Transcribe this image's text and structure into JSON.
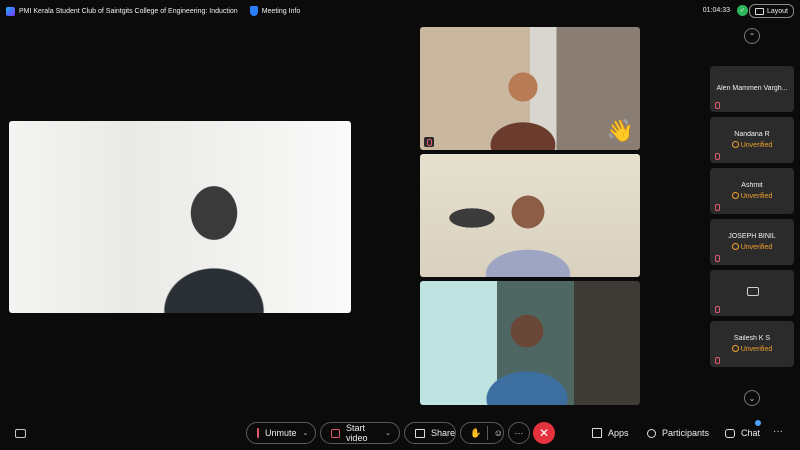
{
  "header": {
    "meeting_title": "PMI Kerala Student Club of Saintgits College of Engineering: Induction",
    "meeting_info_label": "Meeting Info",
    "timer": "01:04:33",
    "layout_label": "Layout"
  },
  "participants_panel": {
    "items": [
      {
        "name": "Alen Mammen Vargh...",
        "status": ""
      },
      {
        "name": "Nandana R",
        "status": "Unverified"
      },
      {
        "name": "Ashmit",
        "status": "Unverified"
      },
      {
        "name": "JOSEPH BINIL",
        "status": "Unverified"
      },
      {
        "name": "",
        "status": ""
      },
      {
        "name": "Sailesh K S",
        "status": "Unverified"
      }
    ]
  },
  "toolbar": {
    "unmute_label": "Unmute",
    "start_video_label": "Start video",
    "share_label": "Share",
    "apps_label": "Apps",
    "participants_label": "Participants",
    "chat_label": "Chat",
    "more_glyph": "···",
    "end_glyph": "✕"
  },
  "icons": {
    "wave": "👋",
    "scroll_up": "⌃",
    "scroll_down": "⌄",
    "chevron_down": "⌄",
    "reactions": "☺",
    "raise_hand": "✋"
  },
  "colors": {
    "background": "#0b0b0b",
    "end_call": "#e5333d",
    "unverified": "#f0a030",
    "muted_red": "#e05a6e",
    "online_green": "#2fb55a"
  }
}
